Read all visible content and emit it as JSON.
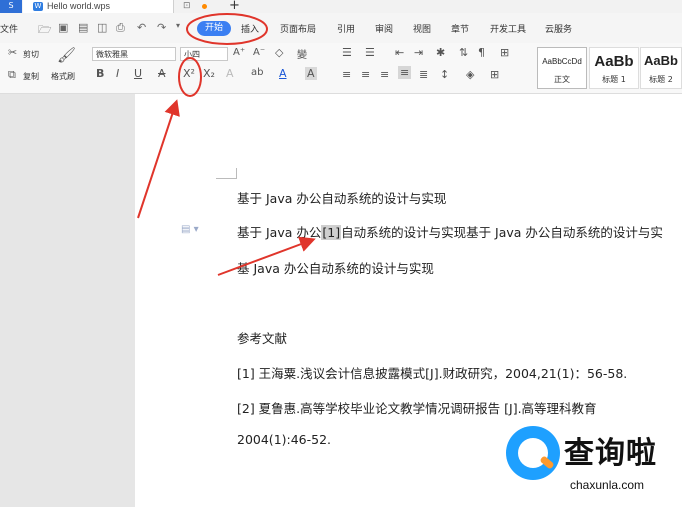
{
  "titlebar": {
    "app_button": "S",
    "doc_icon": "W",
    "doc_name": "Hello world.wps",
    "plus": "+"
  },
  "menubar": {
    "file": "文件",
    "tabs": [
      {
        "label": "开始",
        "active": true
      },
      {
        "label": "插入"
      },
      {
        "label": "页面布局"
      },
      {
        "label": "引用"
      },
      {
        "label": "审阅"
      },
      {
        "label": "视图"
      },
      {
        "label": "章节"
      },
      {
        "label": "开发工具"
      },
      {
        "label": "云服务"
      }
    ]
  },
  "ribbon": {
    "cut": "剪切",
    "copy": "复制",
    "format_painter": "格式刷",
    "font_name": "微软雅黑",
    "font_size": "小四",
    "bold": "B",
    "italic": "I",
    "underline": "U",
    "strikethrough": "A",
    "superscript": "X²",
    "subscript": "X₂",
    "styles": [
      {
        "sample": "AaBbCcDd",
        "label": "正文"
      },
      {
        "sample": "AaBb",
        "label": "标题 1"
      },
      {
        "sample": "AaBb",
        "label": "标题 2"
      }
    ]
  },
  "document": {
    "line1": "基于 Java 办公自动系统的设计与实现",
    "line2_pre": "基于 Java 办公",
    "line2_cite": "[1]",
    "line2_post": "自动系统的设计与实现基于 Java 办公自动系统的设计与实",
    "line3": "基 Java 办公自动系统的设计与实现",
    "ref_title": "参考文献",
    "ref1": "[1]  王海粟.浅议会计信息披露模式[J].财政研究，2004,21(1)：56-58.",
    "ref2": "[2]  夏鲁惠.高等学校毕业论文教学情况调研报告 [J].高等理科教育",
    "ref2_cont": "2004(1):46-52."
  },
  "watermark": {
    "text": "查询啦",
    "url": "chaxunla.com"
  },
  "colors": {
    "accent_blue": "#3b7ff2",
    "annotation_red": "#e0352b"
  }
}
